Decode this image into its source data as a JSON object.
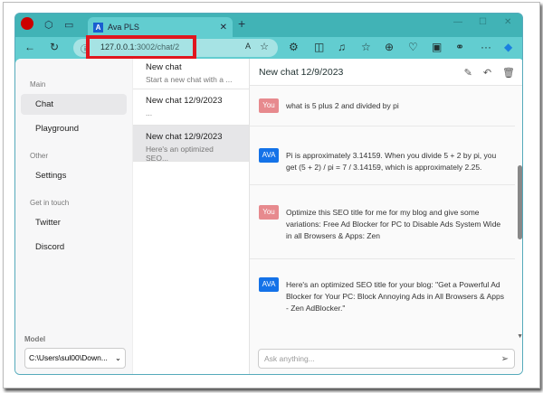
{
  "browser": {
    "tab_title": "Ava PLS",
    "url_host": "127.0.0.1",
    "url_path": ":3002/chat/2",
    "tab_favicon": "A"
  },
  "sidebar": {
    "sections": [
      {
        "label": "Main",
        "items": [
          "Chat",
          "Playground"
        ]
      },
      {
        "label": "Other",
        "items": [
          "Settings"
        ]
      },
      {
        "label": "Get in touch",
        "items": [
          "Twitter",
          "Discord"
        ]
      }
    ],
    "model_label": "Model",
    "model_value": "C:\\Users\\sul00\\Down..."
  },
  "chats": [
    {
      "title": "New chat",
      "snippet": "Start a new chat with a ..."
    },
    {
      "title": "New chat 12/9/2023",
      "snippet": "..."
    },
    {
      "title": "New chat 12/9/2023",
      "snippet": "Here's an optimized SEO..."
    }
  ],
  "main": {
    "title": "New chat 12/9/2023",
    "input_placeholder": "Ask anything...",
    "messages": [
      {
        "role": "You",
        "text": "what is 5 plus 2 and divided by pi"
      },
      {
        "role": "AVA",
        "text": "Pi is approximately 3.14159. When you divide 5 + 2 by pi, you get (5 + 2) / pi = 7 / 3.14159, which is approximately 2.25."
      },
      {
        "role": "You",
        "text": "Optimize this SEO title for me for my blog and give some variations: Free Ad Blocker for PC to Disable Ads System Wide in all Browsers & Apps: Zen"
      },
      {
        "role": "AVA",
        "text": "Here's an optimized SEO title for your blog: \"Get a Powerful Ad Blocker for Your PC: Block Annoying Ads in All Browsers & Apps - Zen AdBlocker.\""
      }
    ]
  }
}
